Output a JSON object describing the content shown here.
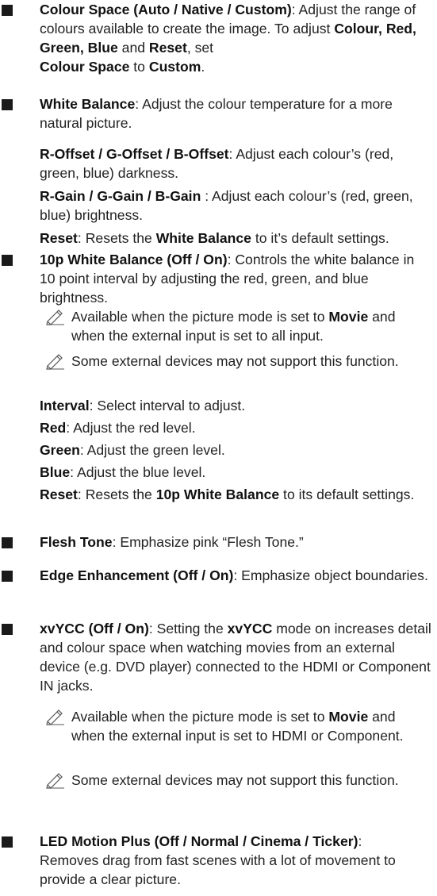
{
  "bullets": [
    {
      "term": "Colour Space (Auto / Native / Custom)",
      "sep": ": ",
      "desc_1": "Adjust the range of colours available to create the image. To adjust ",
      "b1": "Colour, Red, Green, Blue",
      "mid1": " and ",
      "b2": "Reset",
      "mid2": ", set ",
      "b3": "Colour Space",
      "mid3": " to ",
      "b4": "Custom",
      "end": "."
    },
    {
      "term": "White Balance",
      "sep": ": ",
      "desc": "Adjust the colour temperature for a more natural picture.",
      "subs": [
        {
          "term": "R-Offset / G-Offset / B-Offset",
          "sep": ": ",
          "desc": "Adjust each colour’s (red, green, blue) darkness."
        },
        {
          "term": "R-Gain / G-Gain / B-Gain",
          "sep": " : ",
          "desc": "Adjust each colour’s (red, green, blue) brightness."
        },
        {
          "term": "Reset",
          "sep": ": ",
          "desc_a": "Resets the ",
          "bold": "White Balance",
          "desc_b": " to it’s default settings."
        }
      ]
    },
    {
      "term": "10p White Balance (Off / On)",
      "sep": ": ",
      "desc": "Controls the white balance in 10 point interval by adjusting the red, green, and blue brightness.",
      "notes": [
        {
          "a": "Available when the picture mode is set to ",
          "bold": "Movie",
          "b": " and when the external input is set to all input."
        },
        {
          "a": "Some external devices may not support this function."
        }
      ],
      "subs": [
        {
          "term": "Interval",
          "sep": ": ",
          "desc": "Select interval to adjust."
        },
        {
          "term": "Red",
          "sep": ": ",
          "desc": "Adjust the red level."
        },
        {
          "term": "Green",
          "sep": ": ",
          "desc": "Adjust the green level."
        },
        {
          "term": "Blue",
          "sep": ": ",
          "desc": "Adjust the blue level."
        },
        {
          "term": "Reset",
          "sep": ": ",
          "desc_a": "Resets the ",
          "bold": "10p White Balance",
          "desc_b": " to its default settings."
        }
      ]
    },
    {
      "term": "Flesh Tone",
      "sep": ": ",
      "desc": "Emphasize pink “Flesh Tone.”"
    },
    {
      "term": "Edge Enhancement (Off / On)",
      "sep": ": ",
      "desc": "Emphasize object boundaries."
    },
    {
      "term": "xvYCC (Off / On)",
      "sep": ": ",
      "desc_a": "Setting the ",
      "bold": "xvYCC",
      "desc_b": " mode on increases detail and colour space when watching movies from an external device (e.g. DVD player) connected to the HDMI or Component IN jacks.",
      "notes": [
        {
          "a": "Available when the picture mode is set to ",
          "bold": "Movie",
          "b": " and when the external input is set to HDMI or Component."
        },
        {
          "a": "Some external devices may not support this function."
        }
      ]
    },
    {
      "term": "LED Motion Plus (Off / Normal / Cinema / Ticker)",
      "sep": ":",
      "desc": "Removes drag from fast scenes with a lot of movement to provide a clear picture."
    }
  ],
  "icons": {
    "bullet": "square-bullet-icon",
    "note": "pencil-note-icon"
  },
  "colors": {
    "text": "#222222",
    "bullet": "#1a1a1a"
  }
}
